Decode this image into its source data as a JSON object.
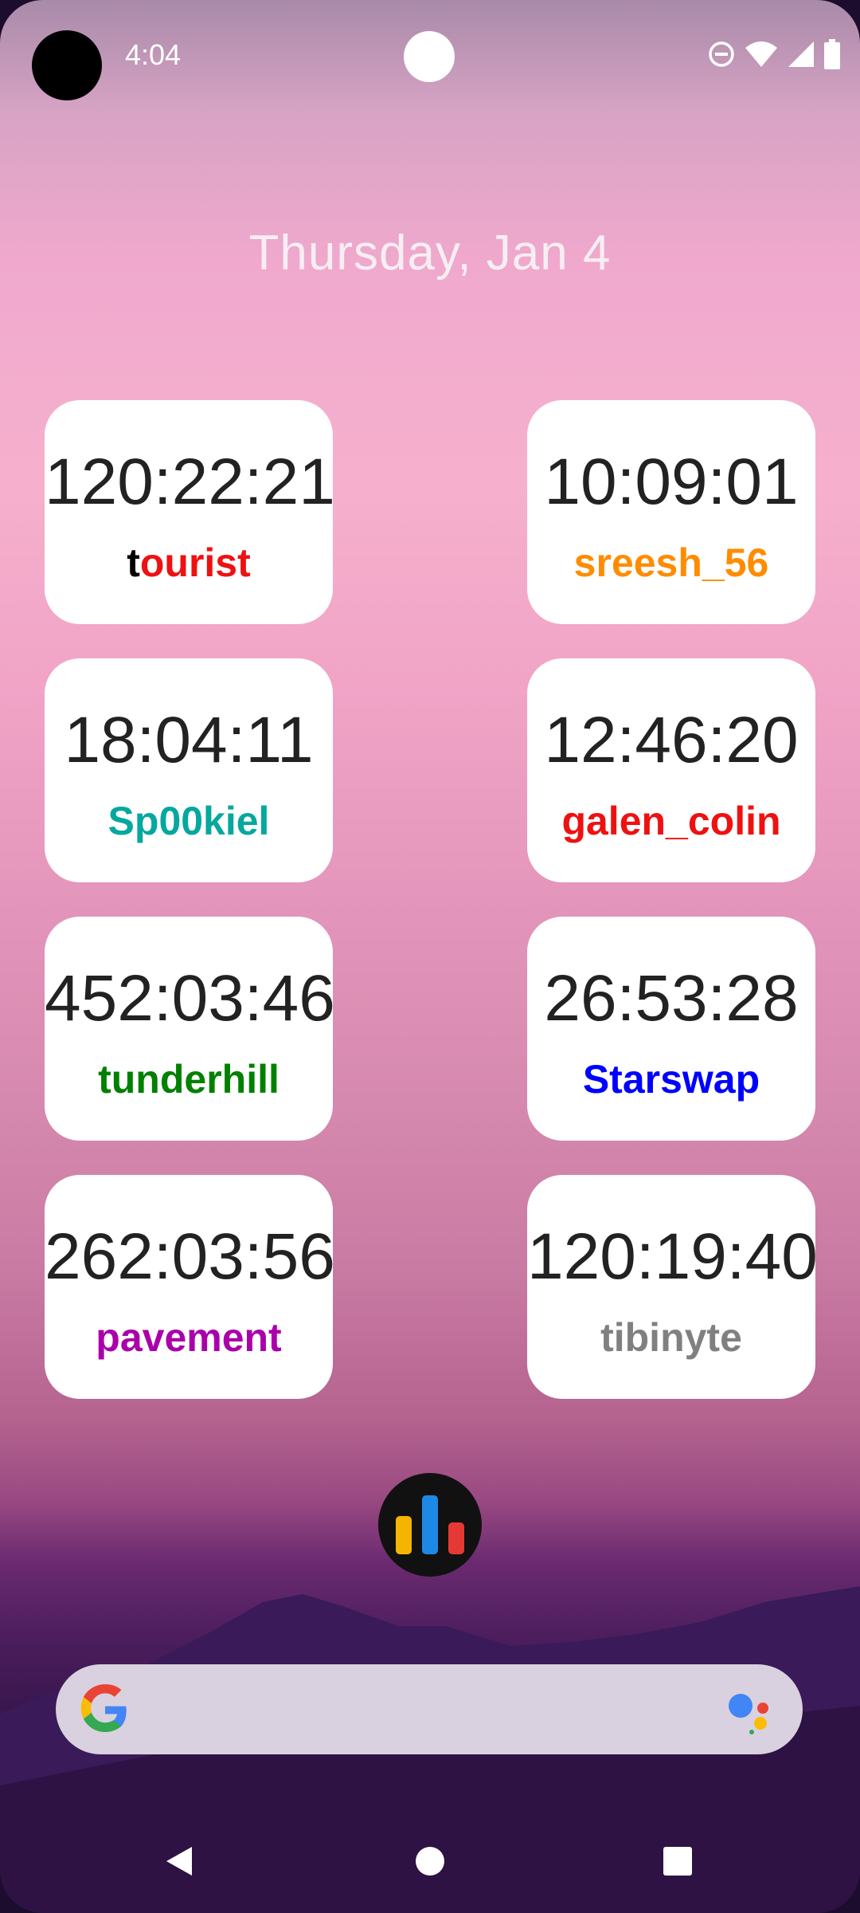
{
  "status_bar": {
    "time": "4:04",
    "icons": [
      "do-not-disturb-icon",
      "wifi-icon",
      "signal-icon",
      "battery-icon"
    ]
  },
  "date": "Thursday, Jan 4",
  "cards": [
    {
      "time": "120:22:21",
      "user_first": "t",
      "user_rest": "ourist",
      "first_color": "#000000",
      "color": "#ee1111"
    },
    {
      "time": "10:09:01",
      "user_first": "",
      "user_rest": "sreesh_56",
      "first_color": "#ff8c00",
      "color": "#ff8c00"
    },
    {
      "time": "18:04:11",
      "user_first": "",
      "user_rest": "Sp00kiel",
      "first_color": "#03a89e",
      "color": "#03a89e"
    },
    {
      "time": "12:46:20",
      "user_first": "",
      "user_rest": "galen_colin",
      "first_color": "#ee1111",
      "color": "#ee1111"
    },
    {
      "time": "452:03:46",
      "user_first": "",
      "user_rest": "tunderhill",
      "first_color": "#008000",
      "color": "#008000"
    },
    {
      "time": "26:53:28",
      "user_first": "",
      "user_rest": "Starswap",
      "first_color": "#0000ff",
      "color": "#0000ff"
    },
    {
      "time": "262:03:56",
      "user_first": "",
      "user_rest": "pavement",
      "first_color": "#aa00aa",
      "color": "#aa00aa"
    },
    {
      "time": "120:19:40",
      "user_first": "",
      "user_rest": "tibinyte",
      "first_color": "#808080",
      "color": "#808080"
    }
  ],
  "app_icon": "bar-chart-app-icon",
  "search": {
    "logo": "google-g-icon",
    "mic": "google-assistant-icon"
  },
  "nav": [
    "back-icon",
    "home-icon",
    "recents-icon"
  ]
}
